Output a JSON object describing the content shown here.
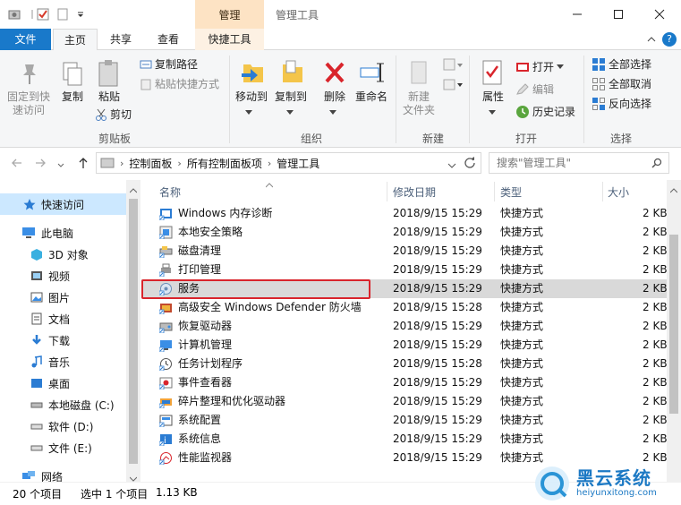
{
  "window": {
    "title": "管理工具",
    "context_tab_label": "管理",
    "controls": [
      "minimize",
      "maximize",
      "close"
    ]
  },
  "tabs": {
    "file": "文件",
    "home": "主页",
    "share": "共享",
    "view": "查看",
    "tools": "快捷工具"
  },
  "ribbon": {
    "clipboard": {
      "label": "剪贴板",
      "pin": "固定到快速访问",
      "pin_line1": "固定到快",
      "pin_line2": "速访问",
      "copy": "复制",
      "paste": "粘贴",
      "copy_path": "复制路径",
      "paste_shortcut": "粘贴快捷方式",
      "cut": "剪切"
    },
    "organize": {
      "label": "组织",
      "move_to": "移动到",
      "copy_to": "复制到",
      "delete": "删除",
      "rename": "重命名"
    },
    "new": {
      "label": "新建",
      "new_folder_line1": "新建",
      "new_folder_line2": "文件夹"
    },
    "open": {
      "label": "打开",
      "properties": "属性",
      "open": "打开",
      "edit": "编辑",
      "history": "历史记录"
    },
    "select": {
      "label": "选择",
      "select_all": "全部选择",
      "select_none": "全部取消",
      "invert": "反向选择"
    }
  },
  "address": {
    "crumbs": [
      "控制面板",
      "所有控制面板项",
      "管理工具"
    ],
    "search_placeholder": "搜索\"管理工具\""
  },
  "nav": {
    "quick_access": "快速访问",
    "this_pc": "此电脑",
    "objects_3d": "3D 对象",
    "videos": "视频",
    "pictures": "图片",
    "documents": "文档",
    "downloads": "下载",
    "music": "音乐",
    "desktop": "桌面",
    "disk_c": "本地磁盘 (C:)",
    "disk_d": "软件 (D:)",
    "disk_e": "文件 (E:)",
    "network": "网络"
  },
  "columns": {
    "name": "名称",
    "date": "修改日期",
    "type": "类型",
    "size": "大小"
  },
  "files": [
    {
      "name": "Windows 内存诊断",
      "date": "2018/9/15 15:29",
      "type": "快捷方式",
      "size": "2 KB"
    },
    {
      "name": "本地安全策略",
      "date": "2018/9/15 15:29",
      "type": "快捷方式",
      "size": "2 KB"
    },
    {
      "name": "磁盘清理",
      "date": "2018/9/15 15:29",
      "type": "快捷方式",
      "size": "2 KB"
    },
    {
      "name": "打印管理",
      "date": "2018/9/15 15:29",
      "type": "快捷方式",
      "size": "2 KB"
    },
    {
      "name": "服务",
      "date": "2018/9/15 15:29",
      "type": "快捷方式",
      "size": "2 KB"
    },
    {
      "name": "高级安全 Windows Defender 防火墙",
      "date": "2018/9/15 15:28",
      "type": "快捷方式",
      "size": "2 KB"
    },
    {
      "name": "恢复驱动器",
      "date": "2018/9/15 15:29",
      "type": "快捷方式",
      "size": "2 KB"
    },
    {
      "name": "计算机管理",
      "date": "2018/9/15 15:29",
      "type": "快捷方式",
      "size": "2 KB"
    },
    {
      "name": "任务计划程序",
      "date": "2018/9/15 15:28",
      "type": "快捷方式",
      "size": "2 KB"
    },
    {
      "name": "事件查看器",
      "date": "2018/9/15 15:29",
      "type": "快捷方式",
      "size": "2 KB"
    },
    {
      "name": "碎片整理和优化驱动器",
      "date": "2018/9/15 15:29",
      "type": "快捷方式",
      "size": "2 KB"
    },
    {
      "name": "系统配置",
      "date": "2018/9/15 15:29",
      "type": "快捷方式",
      "size": "2 KB"
    },
    {
      "name": "系统信息",
      "date": "2018/9/15 15:29",
      "type": "快捷方式",
      "size": "2 KB"
    },
    {
      "name": "性能监视器",
      "date": "2018/9/15 15:29",
      "type": "快捷方式",
      "size": "2 KB"
    }
  ],
  "status": {
    "item_count": "20 个项目",
    "selected": "选中 1 个项目",
    "size": "1.13 KB"
  },
  "watermark": {
    "brand": "黑云系统",
    "url": "heiyunxitong.com"
  },
  "colors": {
    "accent": "#1979ca",
    "context_tab": "#fde3c4",
    "selection_box": "#d9252c",
    "nav_selected": "#cce8ff"
  }
}
